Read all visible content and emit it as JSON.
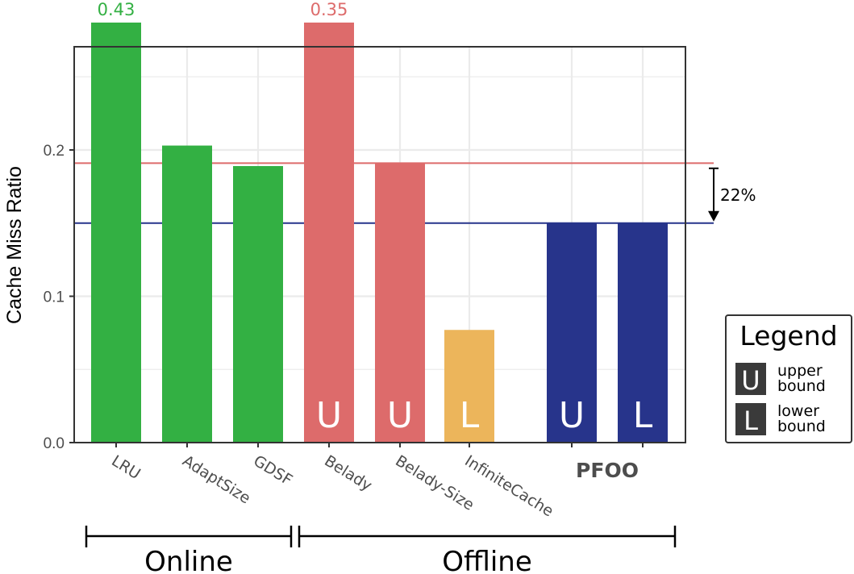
{
  "chart_data": {
    "type": "bar",
    "title": "",
    "xlabel": "",
    "ylabel": "Cache Miss Ratio",
    "ylim": [
      0,
      0.27
    ],
    "yticks": [
      0.0,
      0.1,
      0.2
    ],
    "ytick_labels": [
      "0.0",
      "0.1",
      "0.2"
    ],
    "grid": true,
    "categories": [
      "LRU",
      "AdaptSize",
      "GDSF",
      "Belady",
      "Belady-Size",
      "InfiniteCache",
      "PFOO",
      "PFOO"
    ],
    "bars": [
      {
        "category": "LRU",
        "value": 0.43,
        "color": "#33b043",
        "letter": "",
        "clipped_label": "0.43",
        "group": "Online"
      },
      {
        "category": "AdaptSize",
        "value": 0.203,
        "color": "#33b043",
        "letter": "",
        "group": "Online"
      },
      {
        "category": "GDSF",
        "value": 0.189,
        "color": "#33b043",
        "letter": "",
        "group": "Online"
      },
      {
        "category": "Belady",
        "value": 0.35,
        "color": "#dd6b6b",
        "letter": "U",
        "clipped_label": "0.35",
        "group": "Offline"
      },
      {
        "category": "Belady-Size",
        "value": 0.191,
        "color": "#dd6b6b",
        "letter": "U",
        "group": "Offline"
      },
      {
        "category": "InfiniteCache",
        "value": 0.077,
        "color": "#ecb55b",
        "letter": "L",
        "group": "Offline"
      },
      {
        "category": "PFOO",
        "value": 0.15,
        "color": "#27348b",
        "letter": "U",
        "group": "Offline"
      },
      {
        "category": "PFOO",
        "value": 0.15,
        "color": "#27348b",
        "letter": "L",
        "group": "Offline"
      }
    ],
    "xtick_labels": [
      {
        "text": "LRU",
        "bold": false
      },
      {
        "text": "AdaptSize",
        "bold": false
      },
      {
        "text": "GDSF",
        "bold": false
      },
      {
        "text": "Belady",
        "bold": false
      },
      {
        "text": "Belady-Size",
        "bold": false
      },
      {
        "text": "InfiniteCache",
        "bold": false
      },
      {
        "text": "PFOO",
        "bold": true
      }
    ],
    "reference_lines": [
      {
        "name": "best-upper-bound",
        "value": 0.191,
        "color": "#dd6b6b"
      },
      {
        "name": "pfoo-bound",
        "value": 0.15,
        "color": "#27348b"
      }
    ],
    "annotation": {
      "text": "22%",
      "from": 0.188,
      "to": 0.15
    },
    "groups": [
      {
        "label": "Online",
        "span": [
          "LRU",
          "GDSF"
        ]
      },
      {
        "label": "Offline",
        "span": [
          "Belady",
          "PFOO"
        ]
      }
    ],
    "legend": {
      "title": "Legend",
      "position": "right",
      "entries": [
        {
          "key": "U",
          "line1": "upper",
          "line2": "bound"
        },
        {
          "key": "L",
          "line1": "lower",
          "line2": "bound"
        }
      ]
    }
  }
}
